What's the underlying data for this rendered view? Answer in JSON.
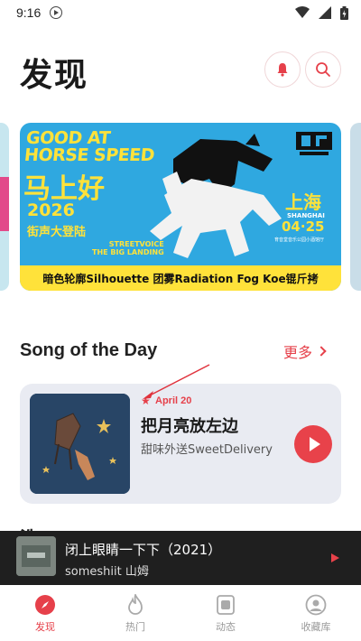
{
  "status": {
    "time": "9:16"
  },
  "header": {
    "title": "发现"
  },
  "banner": {
    "line1": "GOOD AT",
    "line1b": "HORSE SPEED",
    "line2": "马上好",
    "line3": "2026",
    "line4": "街声大登陆",
    "line5a": "STREETVOICE",
    "line5b": "THE BIG LANDING",
    "city": "上海",
    "city_en": "SHANGHAI",
    "date": "04·25",
    "venue": "育音堂音乐公园小酒馆厅",
    "lineup": "暗色轮廓Silhouette  团雾Radiation Fog  Koe锟斤拷",
    "accent": "#ffe23a",
    "bg": "#2fa8e0"
  },
  "song_section": {
    "title": "Song of the Day",
    "more": "更多"
  },
  "song": {
    "date": "April 20",
    "title": "把月亮放左边",
    "artist": "甜味外送SweetDelivery"
  },
  "peek_section": {
    "title": "洗"
  },
  "mini_player": {
    "title": "闭上眼睛一下下（2021）",
    "artist": "someshiit 山姆"
  },
  "nav": [
    {
      "label": "发现",
      "icon": "compass-icon"
    },
    {
      "label": "热门",
      "icon": "flame-icon"
    },
    {
      "label": "动态",
      "icon": "feed-icon"
    },
    {
      "label": "收藏库",
      "icon": "profile-icon"
    }
  ],
  "colors": {
    "accent": "#e6404a",
    "card": "#e9ebf2",
    "player": "#1f1f1f"
  }
}
